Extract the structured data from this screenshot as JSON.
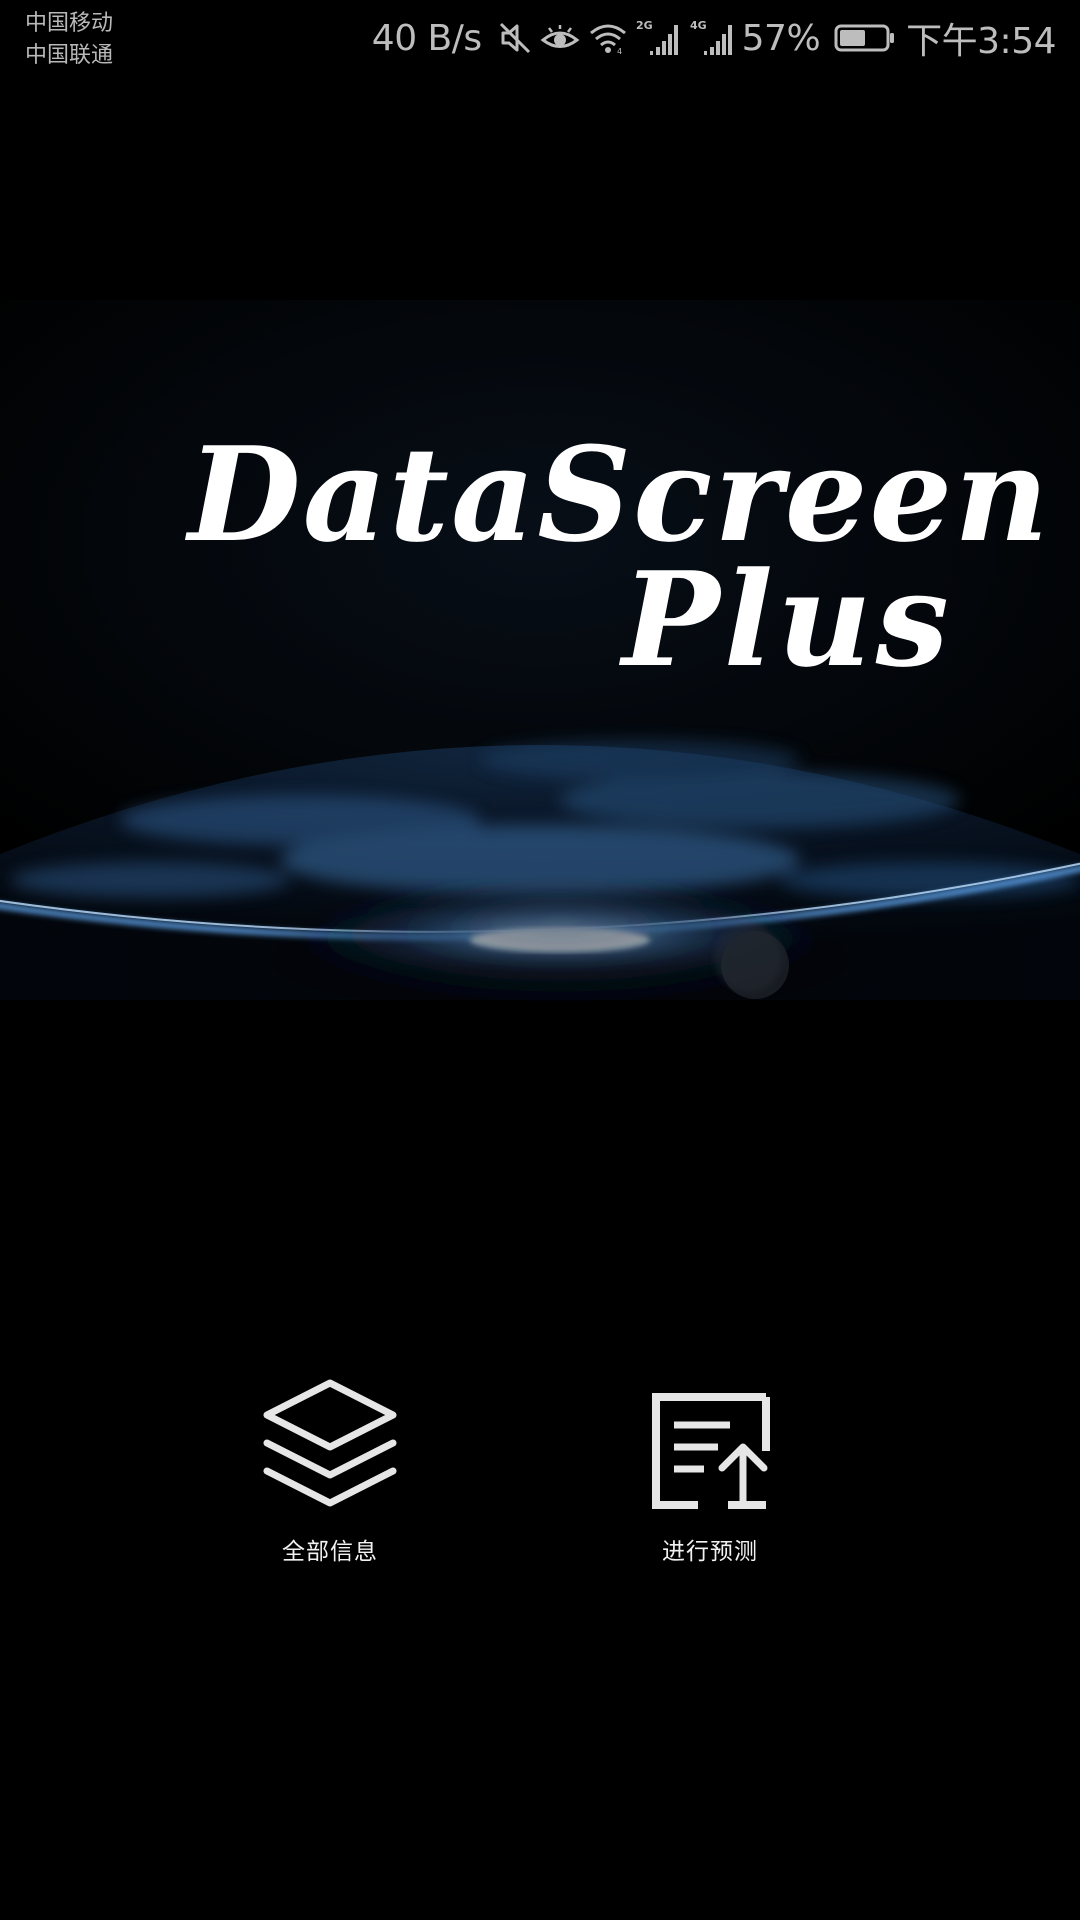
{
  "status_bar": {
    "carrier_1": "中国移动",
    "carrier_2": "中国联通",
    "net_speed": "40 B/s",
    "signal_1_type": "2G",
    "signal_2_type": "4G",
    "battery_percent": "57%",
    "battery_level": 0.57,
    "time": "下午3:54",
    "icons": [
      "mute-icon",
      "eye-comfort-icon",
      "wifi-icon",
      "signal-2g-icon",
      "signal-4g-icon",
      "battery-icon"
    ]
  },
  "logo": {
    "line1": "DataScreen",
    "line2": "Plus"
  },
  "actions": {
    "all_info": {
      "label": "全部信息",
      "icon": "layers-icon"
    },
    "predict": {
      "label": "进行预测",
      "icon": "upload-document-icon"
    }
  },
  "colors": {
    "background": "#000000",
    "horizon_glow": "#4a8fd9",
    "status_text": "#bdbdbd",
    "foreground": "#ffffff"
  }
}
